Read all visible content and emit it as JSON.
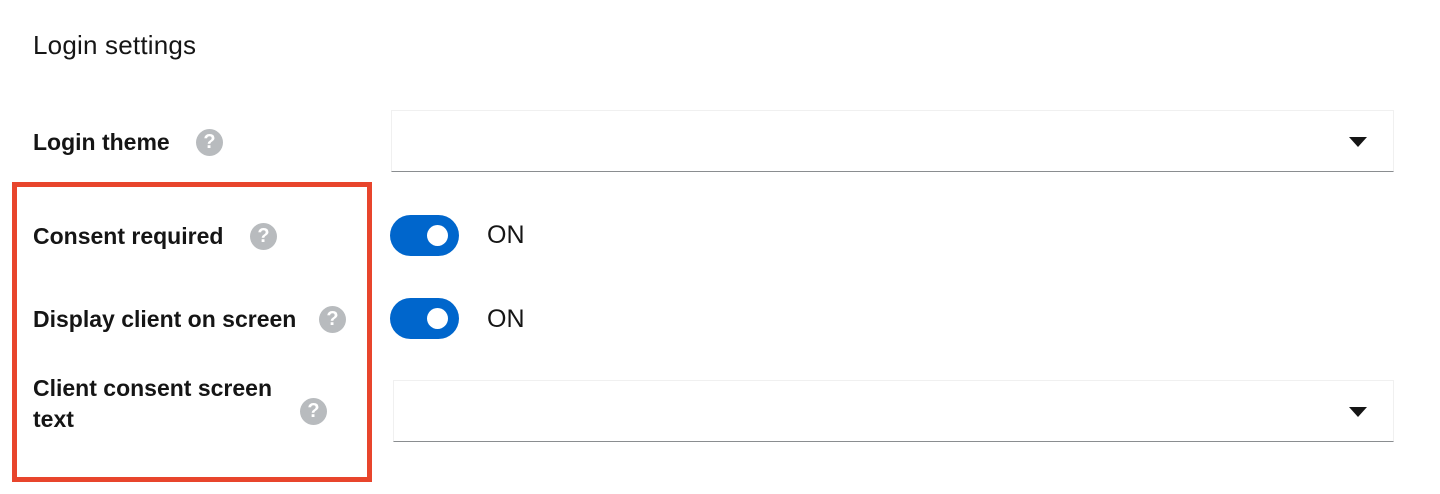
{
  "section": {
    "title": "Login settings"
  },
  "fields": {
    "login_theme": {
      "label": "Login theme",
      "help_icon": "question-circle-icon",
      "value": ""
    },
    "consent_required": {
      "label": "Consent required",
      "help_icon": "question-circle-icon",
      "state": "ON"
    },
    "display_client": {
      "label": "Display client on screen",
      "help_icon": "question-circle-icon",
      "state": "ON"
    },
    "consent_text": {
      "label_line1": "Client consent screen",
      "label_line2": "text",
      "help_icon": "question-circle-icon",
      "value": ""
    }
  },
  "colors": {
    "toggle_on": "#0066cc",
    "highlight_border": "#e8452c",
    "help_icon": "#b8bbbe"
  }
}
